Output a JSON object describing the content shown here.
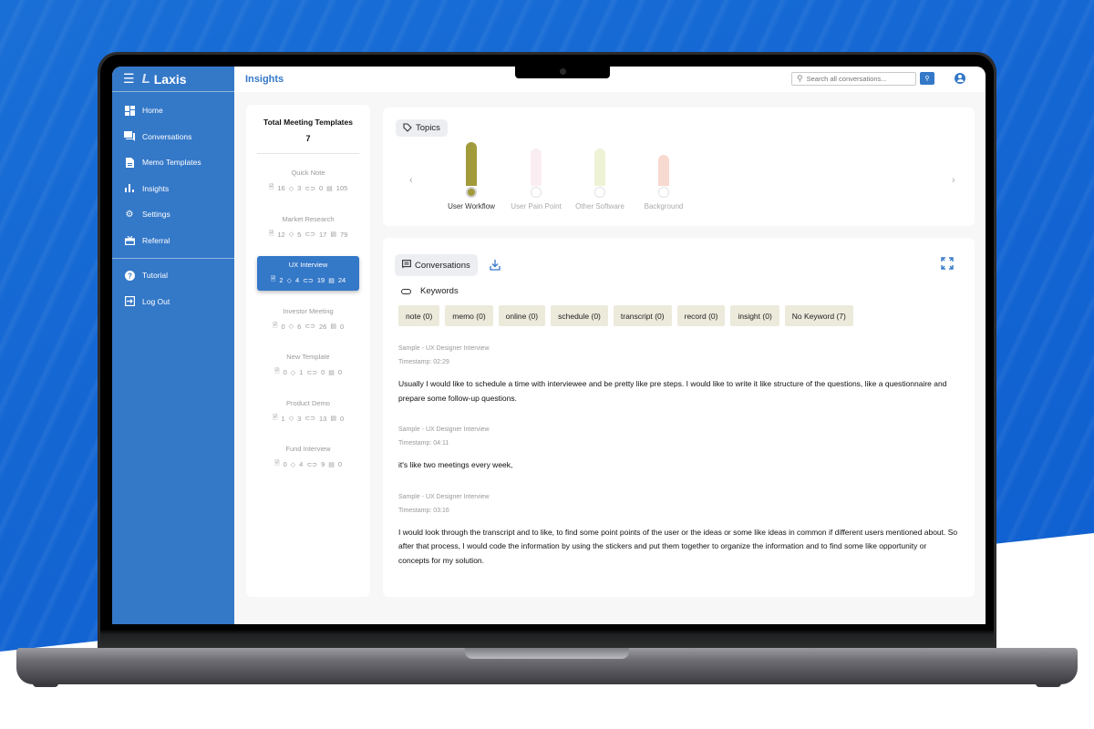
{
  "app": {
    "brand_name": "Laxis",
    "page_title": "Insights"
  },
  "sidebar": {
    "items": [
      {
        "label": "Home",
        "icon": "dashboard-icon"
      },
      {
        "label": "Conversations",
        "icon": "chat-icon"
      },
      {
        "label": "Memo Templates",
        "icon": "document-icon"
      },
      {
        "label": "Insights",
        "icon": "bar-chart-icon"
      },
      {
        "label": "Settings",
        "icon": "gear-icon"
      },
      {
        "label": "Referral",
        "icon": "gift-icon"
      }
    ],
    "bottom_items": [
      {
        "label": "Tutorial",
        "icon": "help-icon"
      },
      {
        "label": "Log Out",
        "icon": "logout-icon"
      }
    ]
  },
  "search": {
    "placeholder": "Search all conversations..."
  },
  "templates": {
    "heading": "Total Meeting Templates",
    "total": "7",
    "items": [
      {
        "name": "Quick Note",
        "docs": "16",
        "topics": "3",
        "keywords": "0",
        "comments": "105",
        "active": false
      },
      {
        "name": "Market Research",
        "docs": "12",
        "topics": "5",
        "keywords": "17",
        "comments": "79",
        "active": false
      },
      {
        "name": "UX Interview",
        "docs": "2",
        "topics": "4",
        "keywords": "19",
        "comments": "24",
        "active": true
      },
      {
        "name": "Investor Meeting",
        "docs": "0",
        "topics": "6",
        "keywords": "26",
        "comments": "0",
        "active": false
      },
      {
        "name": "New Template",
        "docs": "0",
        "topics": "1",
        "keywords": "0",
        "comments": "0",
        "active": false
      },
      {
        "name": "Product Demo",
        "docs": "1",
        "topics": "3",
        "keywords": "13",
        "comments": "0",
        "active": false
      },
      {
        "name": "Fund Interview",
        "docs": "0",
        "topics": "4",
        "keywords": "9",
        "comments": "0",
        "active": false
      }
    ]
  },
  "topics": {
    "heading": "Topics",
    "items": [
      {
        "label": "User Workflow",
        "level": 1.0,
        "color": "#a19b3c",
        "selected": true
      },
      {
        "label": "User Pain Point",
        "level": 0.85,
        "color": "#fbeef2",
        "selected": false
      },
      {
        "label": "Other Software",
        "level": 0.85,
        "color": "#eef3d6",
        "selected": false
      },
      {
        "label": "Background",
        "level": 0.7,
        "color": "#f8d9cf",
        "selected": false
      }
    ]
  },
  "conversations": {
    "heading": "Conversations",
    "keywords_heading": "Keywords",
    "keywords": [
      "note (0)",
      "memo (0)",
      "online (0)",
      "schedule (0)",
      "transcript (0)",
      "record (0)",
      "insight (0)",
      "No Keyword (7)"
    ],
    "entries": [
      {
        "source": "Sample - UX Designer Interview",
        "timestamp": "Timestamp: 02:29",
        "text": "Usually I would like to schedule a time with interviewee and be pretty like pre steps. I would like to write it like structure of the questions, like a questionnaire and prepare some follow-up questions."
      },
      {
        "source": "Sample - UX Designer Interview",
        "timestamp": "Timestamp: 04:11",
        "text": "it's like two meetings every week,"
      },
      {
        "source": "Sample - UX Designer Interview",
        "timestamp": "Timestamp: 03:16",
        "text": "I would look through the transcript and to like, to find some point points of the user or the ideas or some like ideas in common if different users mentioned about. So after that process, I would code the information by using the stickers and put them together to organize the information and to find some like opportunity or concepts for my solution."
      }
    ]
  },
  "colors": {
    "brand_blue": "#3478c8",
    "keyword_chip": "#eceadb",
    "background_blue": "#1466d3"
  }
}
